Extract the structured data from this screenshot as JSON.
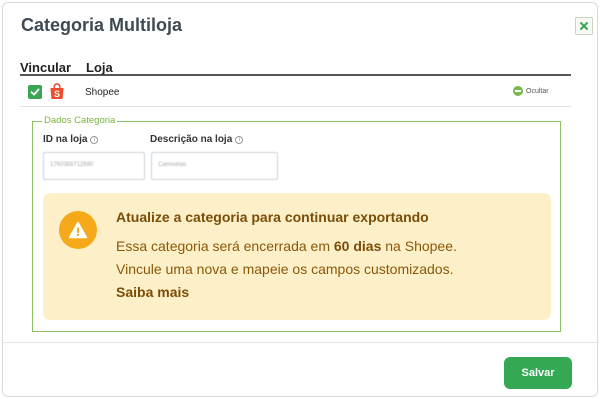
{
  "modal": {
    "title": "Categoria Multiloja",
    "close_icon": "close-x-icon"
  },
  "table": {
    "headers": [
      "Vincular",
      "Loja"
    ],
    "rows": [
      {
        "linked": true,
        "store_icon": "shopee-bag-icon",
        "store": "Shopee",
        "hide_label": "Ocultar"
      }
    ]
  },
  "category": {
    "legend": "Dados Categoria",
    "id_label": "ID na loja",
    "desc_label": "Descrição na loja",
    "info_icon": "info-circle-icon",
    "id_value": "1760388712690",
    "desc_value": "Camisetas"
  },
  "alert": {
    "icon": "warning-triangle-icon",
    "title": "Atualize a categoria para continuar exportando",
    "line1_pre": "Essa categoria será encerrada em ",
    "line1_bold": "60 dias",
    "line1_post": " na Shopee.",
    "line2": "Vincule uma nova e mapeie os campos customizados.",
    "link": "Saiba mais"
  },
  "footer": {
    "save_label": "Salvar"
  },
  "colors": {
    "accent_green": "#34a853",
    "fieldset_border": "#8cc063",
    "alert_bg": "#fdf0c9",
    "warning_orange": "#f5a818",
    "shopee_orange": "#ee4d2d"
  }
}
